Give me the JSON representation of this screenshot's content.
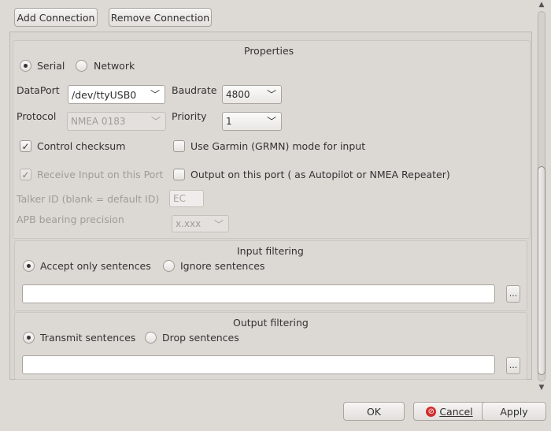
{
  "toolbar": {
    "add_label": "Add Connection",
    "remove_label": "Remove Connection"
  },
  "properties": {
    "title": "Properties",
    "serial_label": "Serial",
    "network_label": "Network",
    "dataport_label": "DataPort",
    "dataport_value": "/dev/ttyUSB0",
    "baudrate_label": "Baudrate",
    "baudrate_value": "4800",
    "protocol_label": "Protocol",
    "protocol_value": "NMEA 0183",
    "priority_label": "Priority",
    "priority_value": "1",
    "control_checksum_label": "Control checksum",
    "garmin_label": "Use Garmin (GRMN) mode for input",
    "receive_input_label": "Receive Input on this Port",
    "output_port_label": "Output on this port ( as Autopilot or NMEA Repeater)",
    "talker_label": "Talker ID (blank = default ID)",
    "talker_value": "EC",
    "apb_label": "APB bearing precision",
    "apb_value": "x.xxx"
  },
  "input_filtering": {
    "title": "Input filtering",
    "accept_label": "Accept only sentences",
    "ignore_label": "Ignore sentences",
    "browse_label": "..."
  },
  "output_filtering": {
    "title": "Output filtering",
    "transmit_label": "Transmit sentences",
    "drop_label": "Drop sentences",
    "browse_label": "..."
  },
  "dialog": {
    "ok_label": "OK",
    "cancel_label": "Cancel",
    "apply_label": "Apply"
  },
  "colors": {
    "window_bg": "#ddd9d5",
    "cancel_icon": "#d22b2b"
  }
}
